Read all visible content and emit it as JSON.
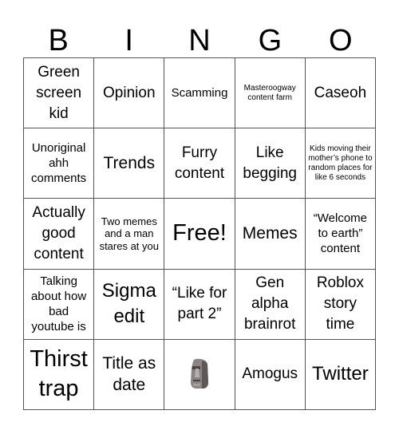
{
  "header": {
    "letters": [
      "B",
      "I",
      "N",
      "G",
      "O"
    ]
  },
  "cells": [
    {
      "text": "Green screen kid",
      "size": "l"
    },
    {
      "text": "Opinion",
      "size": "l"
    },
    {
      "text": "Scamming",
      "size": "m"
    },
    {
      "text": "Masteroogway content farm",
      "size": "xs"
    },
    {
      "text": "Caseoh",
      "size": "l"
    },
    {
      "text": "Unoriginal ahh comments",
      "size": "m"
    },
    {
      "text": "Trends",
      "size": "xl"
    },
    {
      "text": "Furry content",
      "size": "l"
    },
    {
      "text": "Like begging",
      "size": "l"
    },
    {
      "text": "Kids moving their mother’s phone to random places for like 6 seconds",
      "size": "xs"
    },
    {
      "text": "Actually good content",
      "size": "l"
    },
    {
      "text": "Two memes and a man stares at you",
      "size": "s"
    },
    {
      "text": "Free!",
      "size": "xxxl"
    },
    {
      "text": "Memes",
      "size": "xl"
    },
    {
      "text": "“Welcome to earth” content",
      "size": "m"
    },
    {
      "text": "Talking about how bad youtube is",
      "size": "m"
    },
    {
      "text": "Sigma edit",
      "size": "xxl"
    },
    {
      "text": "“Like for part 2”",
      "size": "l"
    },
    {
      "text": "Gen alpha brainrot",
      "size": "l"
    },
    {
      "text": "Roblox story time",
      "size": "l"
    },
    {
      "text": "Thirst trap",
      "size": "xxxl"
    },
    {
      "text": "Title as date",
      "size": "xl"
    },
    {
      "text": "",
      "size": "l",
      "icon": "moai-icon"
    },
    {
      "text": "Amogus",
      "size": "l"
    },
    {
      "text": "Twitter",
      "size": "xxl"
    }
  ]
}
